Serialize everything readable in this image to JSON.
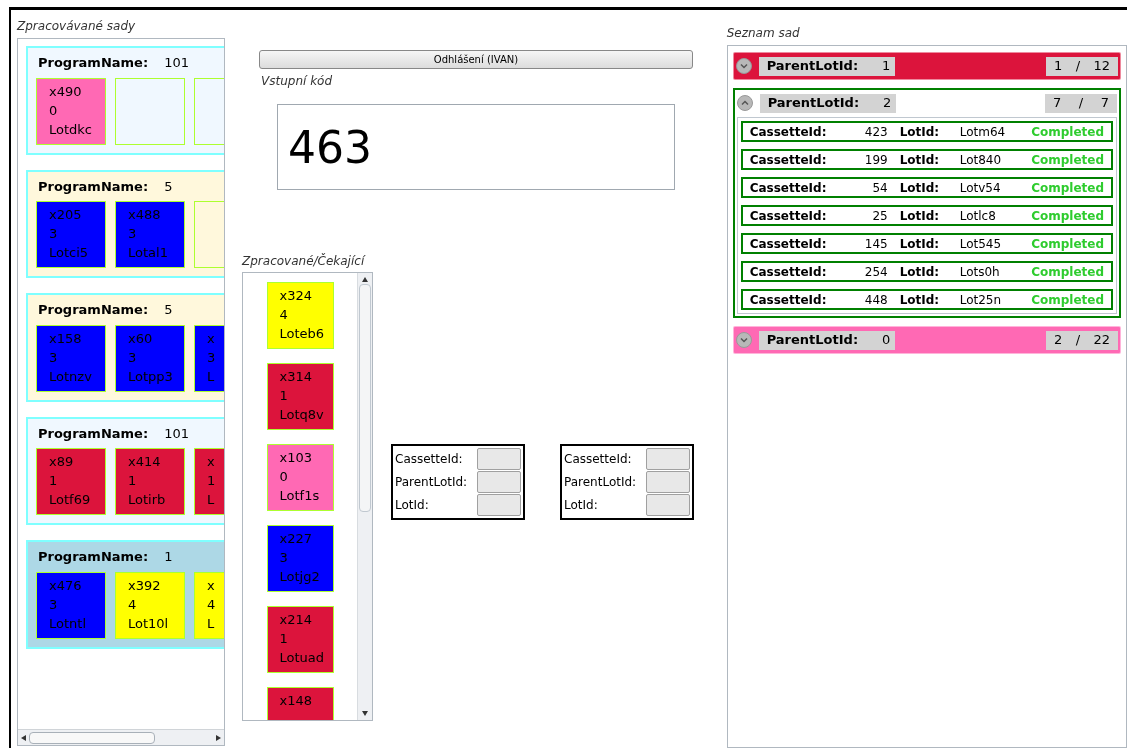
{
  "left_panel": {
    "title": "Zpracovávané sady",
    "groups": [
      {
        "label": "ProgramName:",
        "value": "101",
        "color": "#f0f8ff",
        "tiles": [
          {
            "kind": "lot",
            "color": "#ff69b4",
            "lines": [
              "x490",
              "0",
              "Lotdkc"
            ]
          },
          {
            "kind": "empty"
          },
          {
            "kind": "empty"
          }
        ]
      },
      {
        "label": "ProgramName:",
        "value": "5",
        "color": "#fff8dc",
        "tiles": [
          {
            "kind": "lot",
            "color": "#0000ff",
            "lines": [
              "x205",
              "3",
              "Lotci5"
            ]
          },
          {
            "kind": "lot",
            "color": "#0000ff",
            "lines": [
              "x488",
              "3",
              "Lotal1"
            ]
          },
          {
            "kind": "empty"
          }
        ]
      },
      {
        "label": "ProgramName:",
        "value": "5",
        "color": "#fff8dc",
        "tiles": [
          {
            "kind": "lot",
            "color": "#0000ff",
            "lines": [
              "x158",
              "3",
              "Lotnzv"
            ]
          },
          {
            "kind": "lot",
            "color": "#0000ff",
            "lines": [
              "x60",
              "3",
              "Lotpp3"
            ]
          },
          {
            "kind": "lot",
            "color": "#0000ff",
            "lines": [
              "x",
              "3",
              "L"
            ]
          }
        ]
      },
      {
        "label": "ProgramName:",
        "value": "101",
        "color": "#f0f8ff",
        "tiles": [
          {
            "kind": "lot",
            "color": "#dc143c",
            "lines": [
              "x89",
              "1",
              "Lotf69"
            ]
          },
          {
            "kind": "lot",
            "color": "#dc143c",
            "lines": [
              "x414",
              "1",
              "Lotirb"
            ]
          },
          {
            "kind": "lot",
            "color": "#dc143c",
            "lines": [
              "x",
              "1",
              "L"
            ]
          }
        ]
      },
      {
        "label": "ProgramName:",
        "value": "1",
        "color": "#add8e6",
        "tiles": [
          {
            "kind": "lot",
            "color": "#0000ff",
            "lines": [
              "x476",
              "3",
              "Lotntl"
            ]
          },
          {
            "kind": "lot",
            "color": "#ffff00",
            "lines": [
              "x392",
              "4",
              "Lot10l"
            ]
          },
          {
            "kind": "lot",
            "color": "#ffff00",
            "lines": [
              "x",
              "4",
              "L"
            ]
          }
        ]
      }
    ]
  },
  "logout_button": "Odhlášení (IVAN)",
  "input": {
    "label": "Vstupní kód",
    "value": "463"
  },
  "queue": {
    "title": "Zpracované/Čekající",
    "tiles": [
      {
        "color": "#ffff00",
        "lines": [
          "x324",
          "4",
          "Loteb6"
        ]
      },
      {
        "color": "#dc143c",
        "lines": [
          "x314",
          "1",
          "Lotq8v"
        ]
      },
      {
        "color": "#ff69b4",
        "lines": [
          "x103",
          "0",
          "Lotf1s"
        ]
      },
      {
        "color": "#0000ff",
        "lines": [
          "x227",
          "3",
          "Lotjg2"
        ]
      },
      {
        "color": "#dc143c",
        "lines": [
          "x214",
          "1",
          "Lotuad"
        ]
      },
      {
        "color": "#dc143c",
        "lines": [
          "x148"
        ]
      }
    ]
  },
  "forms": [
    {
      "fields": [
        {
          "label": "CassetteId:"
        },
        {
          "label": "ParentLotId:"
        },
        {
          "label": "LotId:"
        }
      ]
    },
    {
      "fields": [
        {
          "label": "CassetteId:"
        },
        {
          "label": "ParentLotId:"
        },
        {
          "label": "LotId:"
        }
      ]
    }
  ],
  "right_panel": {
    "title": "Seznam sad",
    "groups": [
      {
        "label": "ParentLotId:",
        "value": "1",
        "done": "1",
        "separator": "/",
        "total": "12",
        "color": "#dc143c",
        "expanded": false
      },
      {
        "label": "ParentLotId:",
        "value": "2",
        "done": "7",
        "separator": "/",
        "total": "7",
        "color": "#ffffff",
        "expanded": true,
        "items": [
          {
            "cassette_label": "CassetteId:",
            "cassette": "423",
            "lot_label": "LotId:",
            "lot": "Lotm64",
            "status": "Completed"
          },
          {
            "cassette_label": "CassetteId:",
            "cassette": "199",
            "lot_label": "LotId:",
            "lot": "Lot840",
            "status": "Completed"
          },
          {
            "cassette_label": "CassetteId:",
            "cassette": "54",
            "lot_label": "LotId:",
            "lot": "Lotv54",
            "status": "Completed"
          },
          {
            "cassette_label": "CassetteId:",
            "cassette": "25",
            "lot_label": "LotId:",
            "lot": "Lotlc8",
            "status": "Completed"
          },
          {
            "cassette_label": "CassetteId:",
            "cassette": "145",
            "lot_label": "LotId:",
            "lot": "Lot545",
            "status": "Completed"
          },
          {
            "cassette_label": "CassetteId:",
            "cassette": "254",
            "lot_label": "LotId:",
            "lot": "Lots0h",
            "status": "Completed"
          },
          {
            "cassette_label": "CassetteId:",
            "cassette": "448",
            "lot_label": "LotId:",
            "lot": "Lot25n",
            "status": "Completed"
          }
        ]
      },
      {
        "label": "ParentLotId:",
        "value": "0",
        "done": "2",
        "separator": "/",
        "total": "22",
        "color": "#ff69b4",
        "expanded": false
      }
    ]
  }
}
